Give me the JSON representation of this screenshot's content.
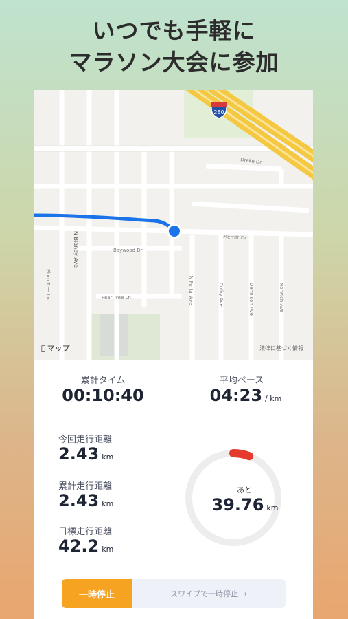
{
  "headline": {
    "line1": "いつでも手軽に",
    "line2": "マラソン大会に参加"
  },
  "map": {
    "logo_text": "マップ",
    "attribution": "法律に基づく情報",
    "highway_shield": "280",
    "streets": {
      "drake": "Drake Dr",
      "merritt": "Merritt Dr",
      "baywood": "Baywood Dr",
      "pear_tree": "Pear Tree Ln",
      "plum_tree": "Plum Tree Ln",
      "n_blaney": "N Blaney Ave",
      "n_portal": "N Portal Ave",
      "colby": "Colby Ave",
      "dennison": "Dennison Ave",
      "norwich": "Norwich Ave"
    }
  },
  "stats": {
    "elapsed_label": "累計タイム",
    "elapsed_value": "00:10:40",
    "pace_label": "平均ペース",
    "pace_value": "04:23",
    "pace_unit": "/ km",
    "current_label": "今回走行距離",
    "current_value": "2.43",
    "total_label": "累計走行距離",
    "total_value": "2.43",
    "goal_label": "目標走行距離",
    "goal_value": "42.2",
    "unit_km": "km",
    "remaining_label": "あと",
    "remaining_value": "39.76",
    "progress_fraction": 0.058
  },
  "controls": {
    "pause_label": "一時停止",
    "swipe_hint": "スワイプで一時停止 →"
  },
  "colors": {
    "accent": "#f6a321",
    "route": "#1a73e8",
    "progress": "#e53b2c",
    "ring": "#ededed"
  }
}
